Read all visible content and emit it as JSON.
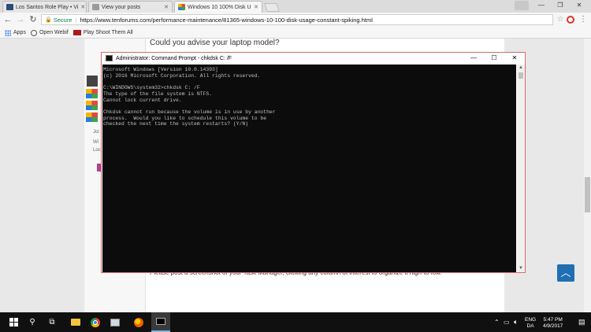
{
  "browser": {
    "tabs": [
      {
        "label": "Los Santos Role Play • Vi",
        "favicon_color": "#2c4a7a"
      },
      {
        "label": "View your posts",
        "favicon_color": "#9a9a9a"
      },
      {
        "label": "Windows 10 100% Disk U",
        "favicon_color": "#e04a3a"
      }
    ],
    "address": {
      "secure_label": "Secure",
      "url": "https://www.tenforums.com/performance-maintenance/81365-windows-10-100-disk-usage-constant-spiking.html"
    },
    "bookmarks": [
      {
        "label": "Apps"
      },
      {
        "label": "Open Webif"
      },
      {
        "label": "Play Shoot Them All"
      }
    ]
  },
  "page": {
    "question": "Could you advise your laptop model?",
    "sidebar_fragments": [
      "Joi",
      "Wi",
      "Loc",
      "Wi",
      "Loc"
    ],
    "bottom_text": "Please post a screenshot of your Task Manager, clicking any column of interest to organize it high-to-low."
  },
  "cmd": {
    "title": "Administrator: Command Prompt - chkdsk  C: /F",
    "lines": [
      "Microsoft Windows [Version 10.0.14393]",
      "(c) 2016 Microsoft Corporation. All rights reserved.",
      "",
      "C:\\WINDOWS\\system32>chkdsk C: /F",
      "The type of the file system is NTFS.",
      "Cannot lock current drive.",
      "",
      "Chkdsk cannot run because the volume is in use by another",
      "process.  Would you like to schedule this volume to be",
      "checked the next time the system restarts? (Y/N)"
    ]
  },
  "tray": {
    "lang_line1": "ENG",
    "lang_line2": "DA",
    "time": "5:47 PM",
    "date": "4/9/2017"
  },
  "colors": {
    "accent": "#1f6fb2",
    "cmd_border": "#d96a6a"
  }
}
